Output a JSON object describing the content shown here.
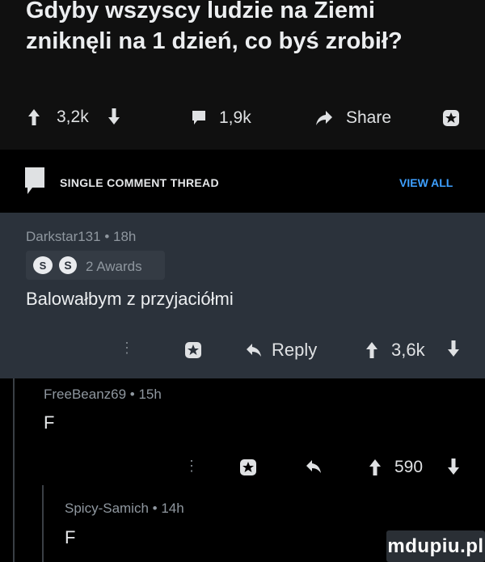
{
  "post": {
    "title": "Gdyby wszyscy ludzie na Ziemi zniknęli na 1 dzień, co byś zrobił?",
    "upvotes": "3,2k",
    "comments": "1,9k",
    "share_label": "Share"
  },
  "thread_bar": {
    "label": "SINGLE COMMENT THREAD",
    "view_all": "VIEW ALL"
  },
  "comments": [
    {
      "meta": "Darkstar131 • 18h",
      "awards": "2 Awards",
      "body": "Balowałbym z przyjaciółmi",
      "reply_label": "Reply",
      "score": "3,6k"
    },
    {
      "meta": "FreeBeanz69 • 15h",
      "body": "F",
      "score": "590"
    },
    {
      "meta": "Spicy-Samich • 14h",
      "body": "F"
    }
  ],
  "watermark": "mdupiu.pl",
  "colors": {
    "header_bg": "#101010",
    "highlight_bg": "#2b323b",
    "view_all": "#3ea0ff"
  }
}
